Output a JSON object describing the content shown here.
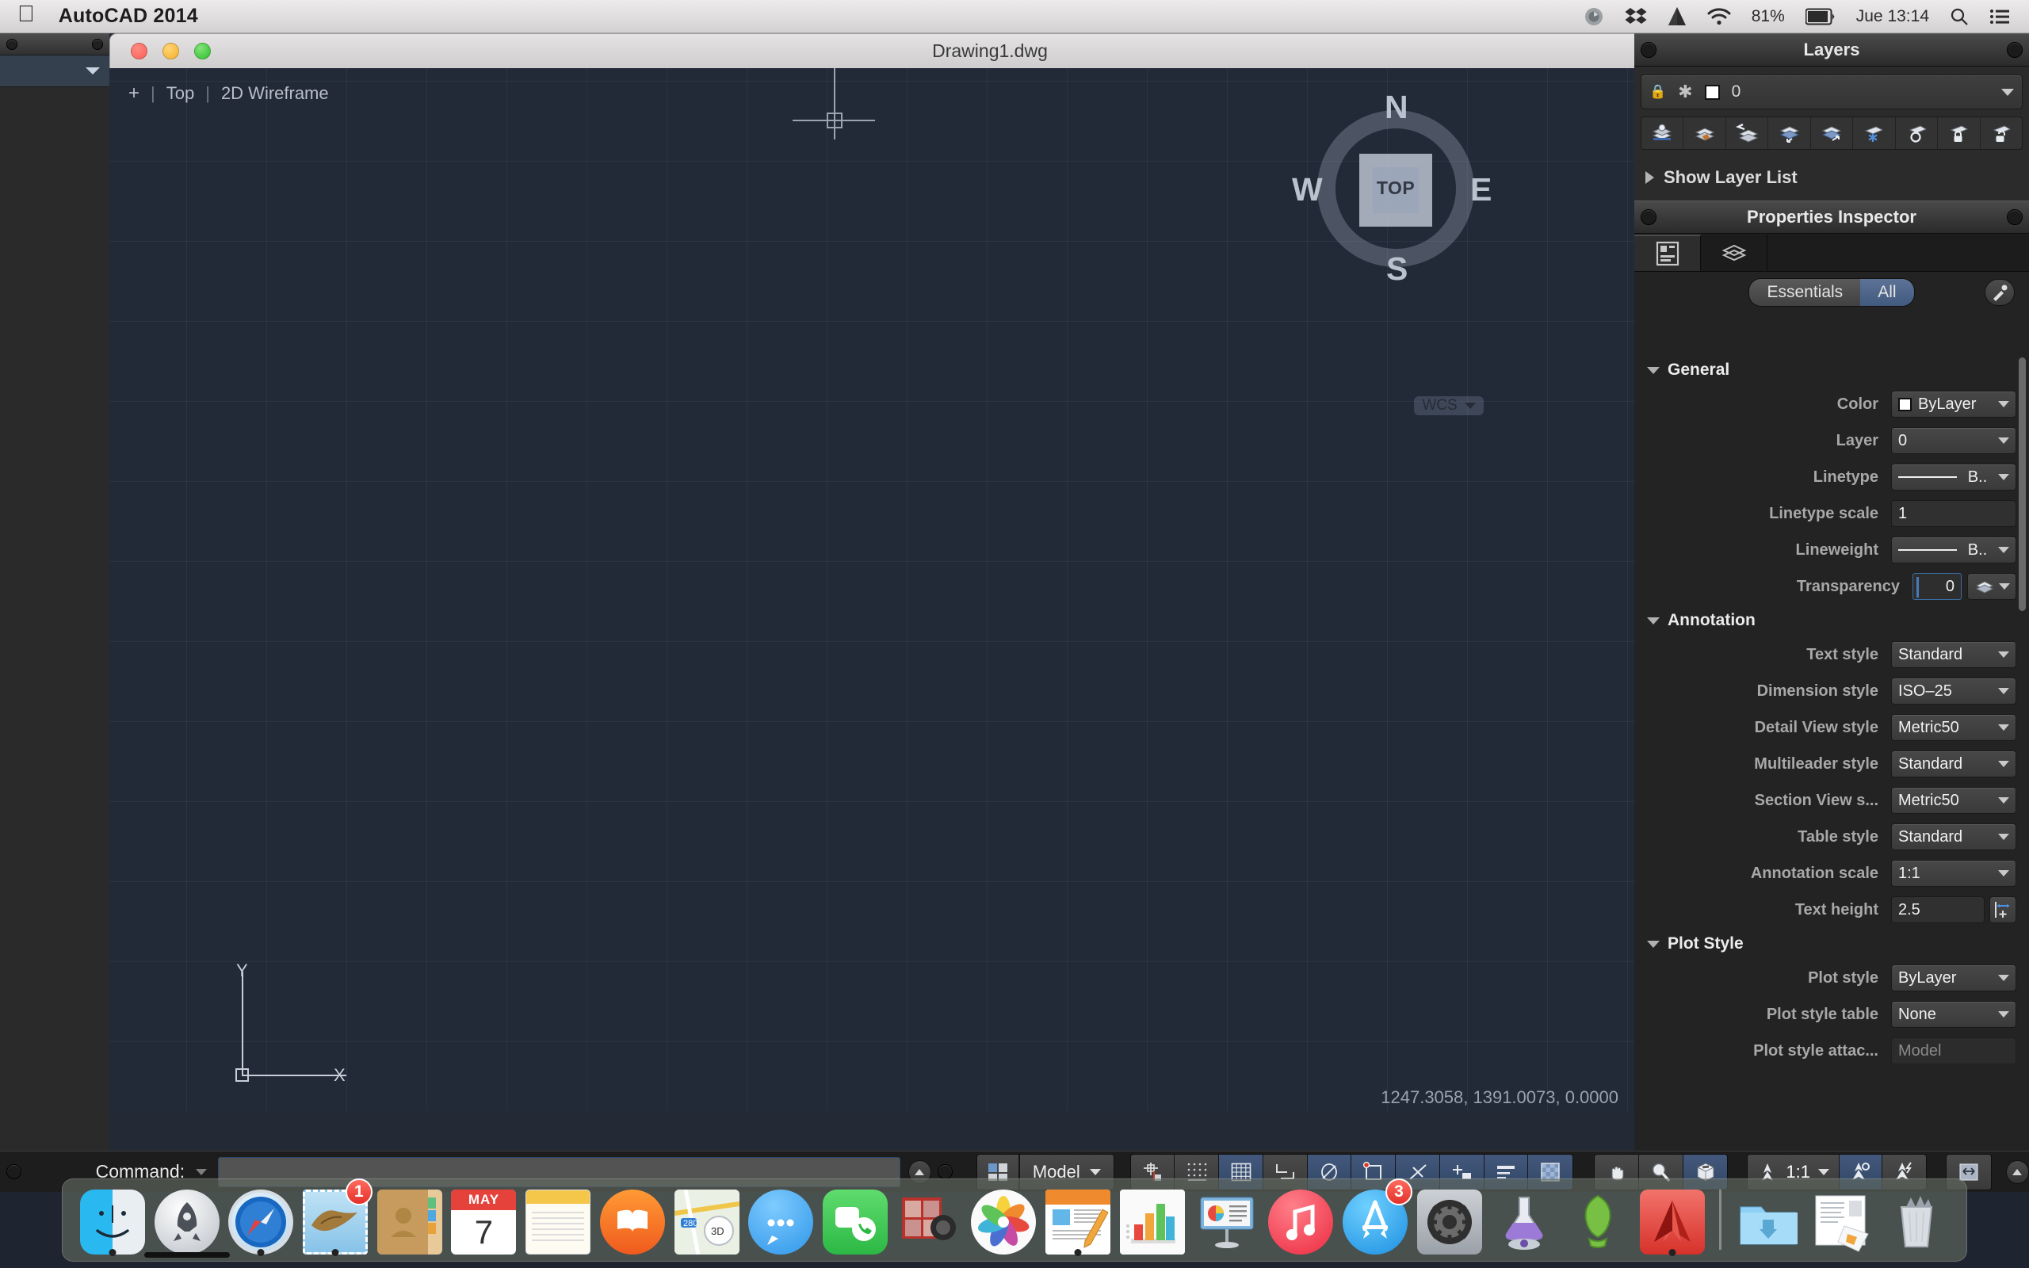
{
  "menubar": {
    "apple_icon": "apple-logo-icon",
    "app_name": "AutoCAD 2014",
    "status_items": [
      {
        "name": "time-machine-icon",
        "label": ""
      },
      {
        "name": "dropbox-icon",
        "label": ""
      },
      {
        "name": "google-drive-icon",
        "label": ""
      },
      {
        "name": "wifi-icon",
        "label": ""
      }
    ],
    "battery_percent": "81%",
    "clock": "Jue 13:14",
    "search_icon": "spotlight-search-icon",
    "notification_icon": "notification-center-icon"
  },
  "document": {
    "title": "Drawing1.dwg",
    "traffic_lights": [
      "close-button",
      "minimize-button",
      "zoom-button"
    ],
    "viewport_label": {
      "plus": "+",
      "view": "Top",
      "visual_style": "2D Wireframe"
    },
    "viewcube": {
      "face": "TOP",
      "north": "N",
      "south": "S",
      "east": "E",
      "west": "W"
    },
    "wcs": "WCS",
    "ucs": {
      "x": "X",
      "y": "Y"
    },
    "coordinates": "1247.3058, 1391.0073, 0.0000"
  },
  "layers_palette": {
    "title": "Layers",
    "current_layer": "0",
    "tools": [
      "layer-properties-icon",
      "layer-match-icon",
      "layer-previous-icon",
      "make-object-layer-current-icon",
      "change-to-current-layer-icon",
      "layer-freeze-icon",
      "layer-off-icon",
      "layer-lock-icon",
      "layer-unlock-icon"
    ],
    "show_layer_list": "Show Layer List"
  },
  "properties_inspector": {
    "title": "Properties Inspector",
    "tabs": [
      {
        "name": "properties-tab",
        "icon": "properties-panel-icon",
        "active": true
      },
      {
        "name": "layers-tab",
        "icon": "layers-stack-icon",
        "active": false
      }
    ],
    "segmented": {
      "essentials": "Essentials",
      "all": "All",
      "selected": "All"
    },
    "eyedropper": "eyedropper-icon",
    "sections": [
      {
        "name": "General",
        "rows": [
          {
            "label": "Color",
            "value": "ByLayer",
            "control": "color-dropdown",
            "swatch": "#ffffff"
          },
          {
            "label": "Layer",
            "value": "0",
            "control": "dropdown"
          },
          {
            "label": "Linetype",
            "value": "B..",
            "control": "linetype-dropdown"
          },
          {
            "label": "Linetype scale",
            "value": "1",
            "control": "text-field"
          },
          {
            "label": "Lineweight",
            "value": "B..",
            "control": "lineweight-dropdown"
          },
          {
            "label": "Transparency",
            "value": "0",
            "control": "transparency-field"
          }
        ]
      },
      {
        "name": "Annotation",
        "rows": [
          {
            "label": "Text style",
            "value": "Standard",
            "control": "dropdown"
          },
          {
            "label": "Dimension style",
            "value": "ISO–25",
            "control": "dropdown"
          },
          {
            "label": "Detail View style",
            "value": "Metric50",
            "control": "dropdown"
          },
          {
            "label": "Multileader style",
            "value": "Standard",
            "control": "dropdown"
          },
          {
            "label": "Section View s...",
            "value": "Metric50",
            "control": "dropdown"
          },
          {
            "label": "Table style",
            "value": "Standard",
            "control": "dropdown"
          },
          {
            "label": "Annotation scale",
            "value": "1:1",
            "control": "dropdown"
          },
          {
            "label": "Text height",
            "value": "2.5",
            "control": "text-field-with-button"
          }
        ]
      },
      {
        "name": "Plot Style",
        "rows": [
          {
            "label": "Plot style",
            "value": "ByLayer",
            "control": "dropdown"
          },
          {
            "label": "Plot style table",
            "value": "None",
            "control": "dropdown"
          },
          {
            "label": "Plot style attac...",
            "value": "Model",
            "control": "readonly-field"
          }
        ]
      }
    ]
  },
  "statusbar": {
    "command_label": "Command:",
    "command_value": "",
    "command_placeholder": "",
    "workspace_icon": "workspace-switch-icon",
    "space": "Model",
    "toggles": [
      {
        "name": "osnap-toggle",
        "icon": "snap-icon",
        "on": false
      },
      {
        "name": "gridsnap-toggle",
        "icon": "grid-snap-icon",
        "on": false
      },
      {
        "name": "grid-display-toggle",
        "icon": "grid-icon",
        "on": true
      },
      {
        "name": "ortho-toggle",
        "icon": "ortho-icon",
        "on": false
      },
      {
        "name": "polar-tracking-toggle",
        "icon": "polar-icon",
        "on": true
      },
      {
        "name": "object-snap-toggle",
        "icon": "object-snap-icon",
        "on": true
      },
      {
        "name": "otrack-toggle",
        "icon": "object-snap-tracking-icon",
        "on": true
      },
      {
        "name": "dynamic-input-toggle",
        "icon": "dynamic-input-icon",
        "on": true
      },
      {
        "name": "lineweight-toggle",
        "icon": "lineweight-display-icon",
        "on": true
      },
      {
        "name": "transparency-toggle",
        "icon": "transparency-display-icon",
        "on": true
      }
    ],
    "nav_tools": [
      {
        "name": "pan-tool",
        "icon": "hand-icon",
        "on": false
      },
      {
        "name": "zoom-tool",
        "icon": "magnifier-icon",
        "on": false
      },
      {
        "name": "orbit-tool",
        "icon": "cube-orbit-icon",
        "on": true
      }
    ],
    "annotation_scale": "1:1",
    "annotation_tools": [
      {
        "name": "annotation-visibility",
        "icon": "annotation-visibility-icon",
        "on": true
      },
      {
        "name": "auto-scale",
        "icon": "auto-add-scale-icon",
        "on": false
      }
    ],
    "fullscreen": "fullscreen-icon",
    "expand": "expand-statusbar-icon"
  },
  "dock": {
    "items": [
      {
        "name": "finder",
        "icon": "finder-icon",
        "running": true,
        "badge": ""
      },
      {
        "name": "launchpad",
        "icon": "launchpad-icon",
        "running": false,
        "badge": ""
      },
      {
        "name": "safari",
        "icon": "safari-icon",
        "running": true,
        "badge": ""
      },
      {
        "name": "mail",
        "icon": "mail-icon",
        "running": true,
        "badge": "1"
      },
      {
        "name": "contacts",
        "icon": "contacts-icon",
        "running": false,
        "badge": ""
      },
      {
        "name": "calendar",
        "icon": "calendar-icon",
        "running": false,
        "badge": "",
        "month": "MAY",
        "day": "7"
      },
      {
        "name": "notes",
        "icon": "notes-icon",
        "running": false,
        "badge": ""
      },
      {
        "name": "ibooks",
        "icon": "ibooks-icon",
        "running": false,
        "badge": ""
      },
      {
        "name": "maps",
        "icon": "maps-icon",
        "running": false,
        "badge": ""
      },
      {
        "name": "messages",
        "icon": "messages-icon",
        "running": false,
        "badge": ""
      },
      {
        "name": "facetime",
        "icon": "facetime-icon",
        "running": false,
        "badge": ""
      },
      {
        "name": "photo-booth",
        "icon": "photo-booth-icon",
        "running": false,
        "badge": ""
      },
      {
        "name": "photos",
        "icon": "photos-icon",
        "running": false,
        "badge": ""
      },
      {
        "name": "pages",
        "icon": "pages-icon",
        "running": true,
        "badge": ""
      },
      {
        "name": "numbers",
        "icon": "numbers-icon",
        "running": false,
        "badge": ""
      },
      {
        "name": "keynote",
        "icon": "keynote-icon",
        "running": false,
        "badge": ""
      },
      {
        "name": "itunes",
        "icon": "itunes-icon",
        "running": false,
        "badge": ""
      },
      {
        "name": "app-store",
        "icon": "app-store-icon",
        "running": false,
        "badge": "3"
      },
      {
        "name": "system-preferences",
        "icon": "system-preferences-icon",
        "running": false,
        "badge": ""
      },
      {
        "name": "xquartz",
        "icon": "flask-icon",
        "running": false,
        "badge": ""
      },
      {
        "name": "skitch",
        "icon": "footprint-icon",
        "running": false,
        "badge": ""
      },
      {
        "name": "autocad",
        "icon": "autocad-icon",
        "running": true,
        "badge": ""
      }
    ],
    "right_items": [
      {
        "name": "downloads-folder",
        "icon": "downloads-folder-icon"
      },
      {
        "name": "documents-stack",
        "icon": "document-stack-icon"
      },
      {
        "name": "trash",
        "icon": "trash-icon"
      }
    ]
  },
  "colors": {
    "canvas_bg": "#222937",
    "panel_bg": "#232323",
    "accent_blue": "#3b6ea5",
    "grid_line": "#3a4354"
  }
}
